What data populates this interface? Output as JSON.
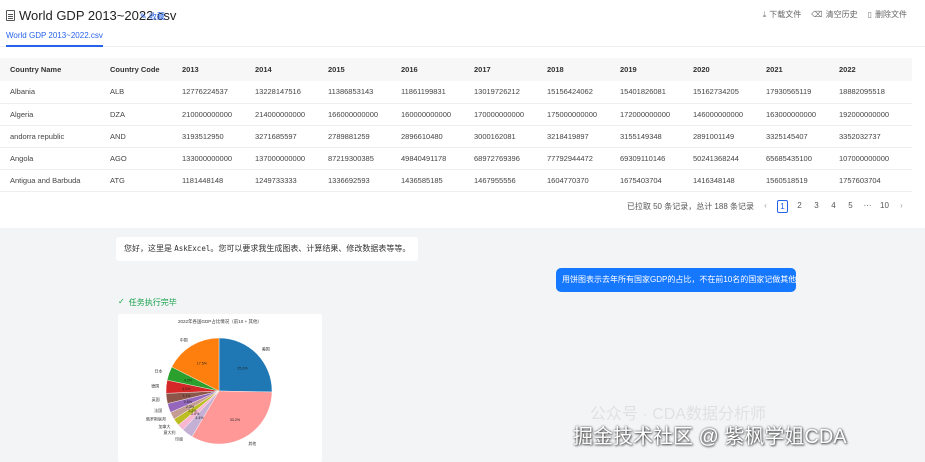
{
  "header": {
    "file_title": "World GDP 2013~2022.csv",
    "favorite_label": "收藏",
    "download_label": "下载文件",
    "clear_history_label": "清空历史",
    "delete_label": "删除文件"
  },
  "tabs": [
    {
      "label": "World GDP 2013~2022.csv",
      "active": true
    }
  ],
  "table": {
    "columns": [
      "Country Name",
      "Country Code",
      "2013",
      "2014",
      "2015",
      "2016",
      "2017",
      "2018",
      "2019",
      "2020",
      "2021",
      "2022"
    ],
    "rows": [
      [
        "Albania",
        "ALB",
        "12776224537",
        "13228147516",
        "11386853143",
        "11861199831",
        "13019726212",
        "15156424062",
        "15401826081",
        "15162734205",
        "17930565119",
        "18882095518"
      ],
      [
        "Algeria",
        "DZA",
        "210000000000",
        "214000000000",
        "166000000000",
        "160000000000",
        "170000000000",
        "175000000000",
        "172000000000",
        "146000000000",
        "163000000000",
        "192000000000"
      ],
      [
        "andorra republic",
        "AND",
        "3193512950",
        "3271685597",
        "2789881259",
        "2896610480",
        "3000162081",
        "3218419897",
        "3155149348",
        "2891001149",
        "3325145407",
        "3352032737"
      ],
      [
        "Angola",
        "AGO",
        "133000000000",
        "137000000000",
        "87219300385",
        "49840491178",
        "68972769396",
        "77792944472",
        "69309110146",
        "50241368244",
        "65685435100",
        "107000000000"
      ],
      [
        "Antigua and Barbuda",
        "ATG",
        "1181448148",
        "1249733333",
        "1336692593",
        "1436585185",
        "1467955556",
        "1604770370",
        "1675403704",
        "1416348148",
        "1560518519",
        "1757603704"
      ]
    ]
  },
  "pager": {
    "summary": "已拉取 50 条记录，总计 188 条记录",
    "pages": [
      "1",
      "2",
      "3",
      "4",
      "5",
      "···",
      "10"
    ],
    "current": "1"
  },
  "chat": {
    "greeting_prefix": "您好，这里是 ",
    "greeting_app": "AskExcel",
    "greeting_suffix": "。您可以要求我生成图表、计算结果、修改数据表等等。",
    "user_message": "用饼图表示去年所有国家GDP的占比，不在前10名的国家记做其他",
    "task_status": "任务执行完毕"
  },
  "chart_data": {
    "type": "pie",
    "title": "2022年各国GDP占比情况（前10 + 其他）",
    "slices": [
      {
        "label": "美国",
        "value": 25.3,
        "color": "#1f77b4"
      },
      {
        "label": "其他",
        "value": 33.2,
        "color": "#ff9896"
      },
      {
        "label": "印度",
        "value": 3.4,
        "color": "#c5b0d5"
      },
      {
        "label": "意大利",
        "value": 2.0,
        "color": "#f7b6d2"
      },
      {
        "label": "加拿大",
        "value": 2.2,
        "color": "#bcbd22"
      },
      {
        "label": "俄罗斯联邦",
        "value": 2.3,
        "color": "#c49c94"
      },
      {
        "label": "法国",
        "value": 2.8,
        "color": "#9467bd"
      },
      {
        "label": "英国",
        "value": 3.1,
        "color": "#8c564b"
      },
      {
        "label": "德国",
        "value": 4.0,
        "color": "#d62728"
      },
      {
        "label": "日本",
        "value": 4.2,
        "color": "#2ca02c"
      },
      {
        "label": "中国",
        "value": 17.5,
        "color": "#ff7f0e"
      }
    ]
  },
  "watermark": {
    "faint": "公众号 · CDA数据分析师",
    "text": "掘金技术社区 @ 紫枫学姐CDA"
  }
}
